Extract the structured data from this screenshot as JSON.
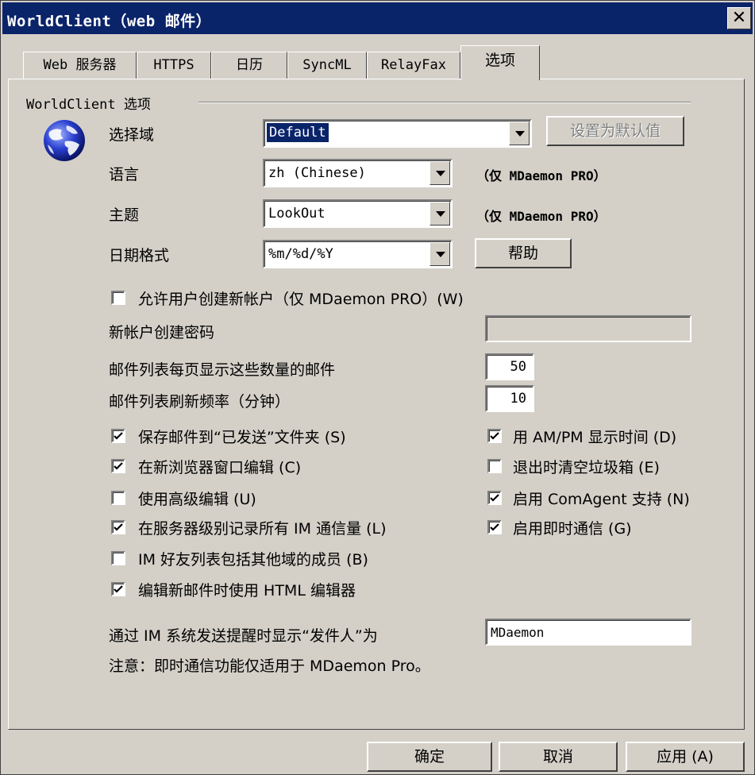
{
  "window": {
    "title": "WorldClient（web 邮件）",
    "close_glyph": "✕"
  },
  "tabs": [
    {
      "label": "Web 服务器"
    },
    {
      "label": "HTTPS"
    },
    {
      "label": "日历"
    },
    {
      "label": "SyncML"
    },
    {
      "label": "RelayFax"
    },
    {
      "label": "选项"
    }
  ],
  "group": {
    "label": "WorldClient 选项"
  },
  "form": {
    "domain_label": "选择域",
    "domain_value": "Default",
    "set_default_label": "设置为默认值",
    "language_label": "语言",
    "language_value": "zh (Chinese)",
    "language_note": "（仅 MDaemon PRO）",
    "theme_label": "主题",
    "theme_value": "LookOut",
    "theme_note": "（仅 MDaemon PRO）",
    "date_label": "日期格式",
    "date_value": "%m/%d/%Y",
    "help_label": "帮助",
    "allow_create_label": "允许用户创建新帐户（仅 MDaemon PRO）(W)",
    "allow_create_checked": false,
    "new_account_pw_label": "新帐户创建密码",
    "new_account_pw_value": "",
    "per_page_label": "邮件列表每页显示这些数量的邮件",
    "per_page_value": "50",
    "refresh_label": "邮件列表刷新频率（分钟）",
    "refresh_value": "10",
    "im_from_label": "通过 IM 系统发送提醒时显示“发件人”为",
    "im_from_value": "MDaemon",
    "note": "注意：即时通信功能仅适用于 MDaemon Pro。"
  },
  "checkboxes_left": [
    {
      "label": "保存邮件到“已发送”文件夹 (S)",
      "checked": true
    },
    {
      "label": "在新浏览器窗口编辑 (C)",
      "checked": true
    },
    {
      "label": "使用高级编辑 (U)",
      "checked": false
    },
    {
      "label": "在服务器级别记录所有 IM 通信量 (L)",
      "checked": true
    },
    {
      "label": "IM 好友列表包括其他域的成员 (B)",
      "checked": false
    },
    {
      "label": "编辑新邮件时使用 HTML 编辑器",
      "checked": true
    }
  ],
  "checkboxes_right": [
    {
      "label": "用 AM/PM 显示时间 (D)",
      "checked": true
    },
    {
      "label": "退出时清空垃圾箱 (E)",
      "checked": false
    },
    {
      "label": "启用 ComAgent 支持 (N)",
      "checked": true
    },
    {
      "label": "启用即时通信 (G)",
      "checked": true
    }
  ],
  "buttons": {
    "ok": "确定",
    "cancel": "取消",
    "apply": "应用 (A)"
  }
}
